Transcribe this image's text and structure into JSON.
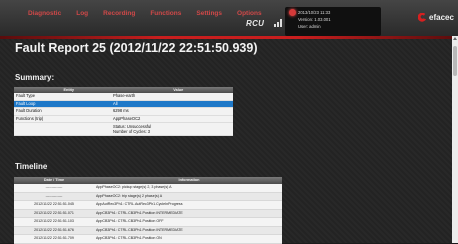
{
  "menu": [
    "Diagnostic",
    "Log",
    "Recording",
    "Functions",
    "Settings",
    "Options"
  ],
  "header": {
    "product": "RCU",
    "datetime": "2013/10/23 11:33",
    "version": "Version: 1.03.001",
    "user": "User: admin",
    "logo": "efacec"
  },
  "title": "Fault Report 25 (2012/11/22 22:51:50.939)",
  "summary": {
    "heading": "Summary:",
    "columns": [
      "Entity",
      "Value"
    ],
    "rows": [
      {
        "k": "Fault Type",
        "v": "Phase-earth"
      },
      {
        "k": "Fault Loop",
        "v": "All"
      },
      {
        "k": "Fault Duration",
        "v": "6298 ms"
      },
      {
        "k": "Functions (trip)",
        "v": "AppPhaseOC2"
      },
      {
        "k": "",
        "v": "Status: Unsuccessful",
        "v2": "Number of Cycles: 3"
      }
    ]
  },
  "timeline": {
    "heading": "Timeline",
    "columns": [
      "Date / Time",
      "Information"
    ],
    "rows": [
      {
        "t": "--------------",
        "i": "AppPhaseOC2: pickup stage(s) 2, 3 phase(s) A"
      },
      {
        "t": "--------------",
        "i": "AppPhaseOC2: trip stage(s) 2 phase(s) A"
      },
      {
        "t": "2012/11/22 22:51:51.045",
        "i": "AppAutRec3Ph1: CTRL.AutRec3Ph1.CycleInProgress"
      },
      {
        "t": "2012/11/22 22:51:51.071",
        "i": "AppCB3Ph1: CTRL.CB3Ph1.Position INTERMEDIATE"
      },
      {
        "t": "2012/11/22 22:51:51.103",
        "i": "AppCB3Ph1: CTRL.CB3Ph1.Position OFF"
      },
      {
        "t": "2012/11/22 22:51:51.676",
        "i": "AppCB3Ph1: CTRL.CB3Ph1.Position INTERMEDIATE"
      },
      {
        "t": "2012/11/22 22:51:51.709",
        "i": "AppCB3Ph1: CTRL.CB3Ph1.Position ON"
      }
    ]
  },
  "colors": {
    "accent": "#c81e1e",
    "selection": "#1e78c8",
    "menu": "#d04848"
  }
}
